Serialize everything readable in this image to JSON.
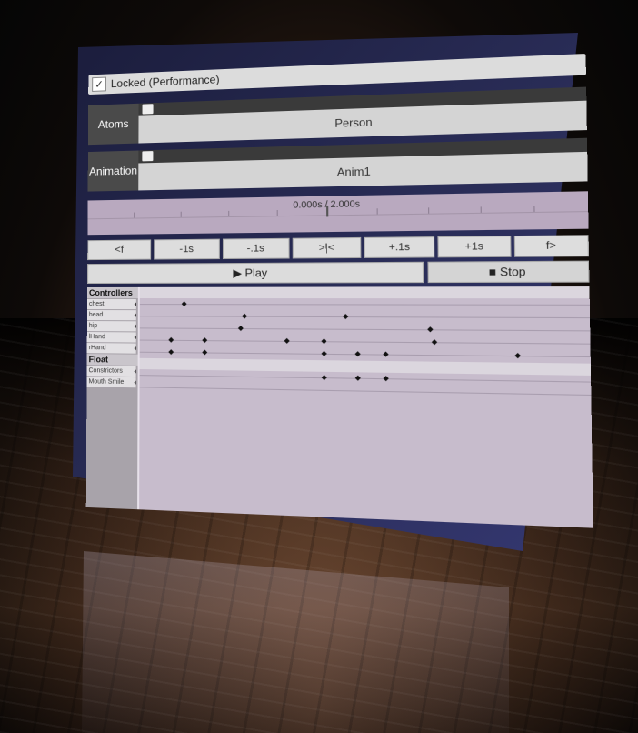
{
  "locked": {
    "label": "Locked (Performance)",
    "checked": true
  },
  "atoms": {
    "label": "Atoms",
    "value": "Person"
  },
  "animation": {
    "label": "Animation",
    "value": "Anim1"
  },
  "scrubber": {
    "time_display": "0.000s / 2.000s"
  },
  "transport": [
    {
      "label": "<f"
    },
    {
      "label": "-1s"
    },
    {
      "label": "-.1s"
    },
    {
      "label": ">|<"
    },
    {
      "label": "+.1s"
    },
    {
      "label": "+1s"
    },
    {
      "label": "f>"
    }
  ],
  "play_label": "▶ Play",
  "stop_label": "■ Stop",
  "controllers": {
    "header": "Controllers",
    "items": [
      "chest",
      "head",
      "hip",
      "lHand",
      "rHand"
    ]
  },
  "float_params": {
    "header": "Float Params",
    "items": [
      "Constrictors",
      "Mouth Smile"
    ]
  }
}
